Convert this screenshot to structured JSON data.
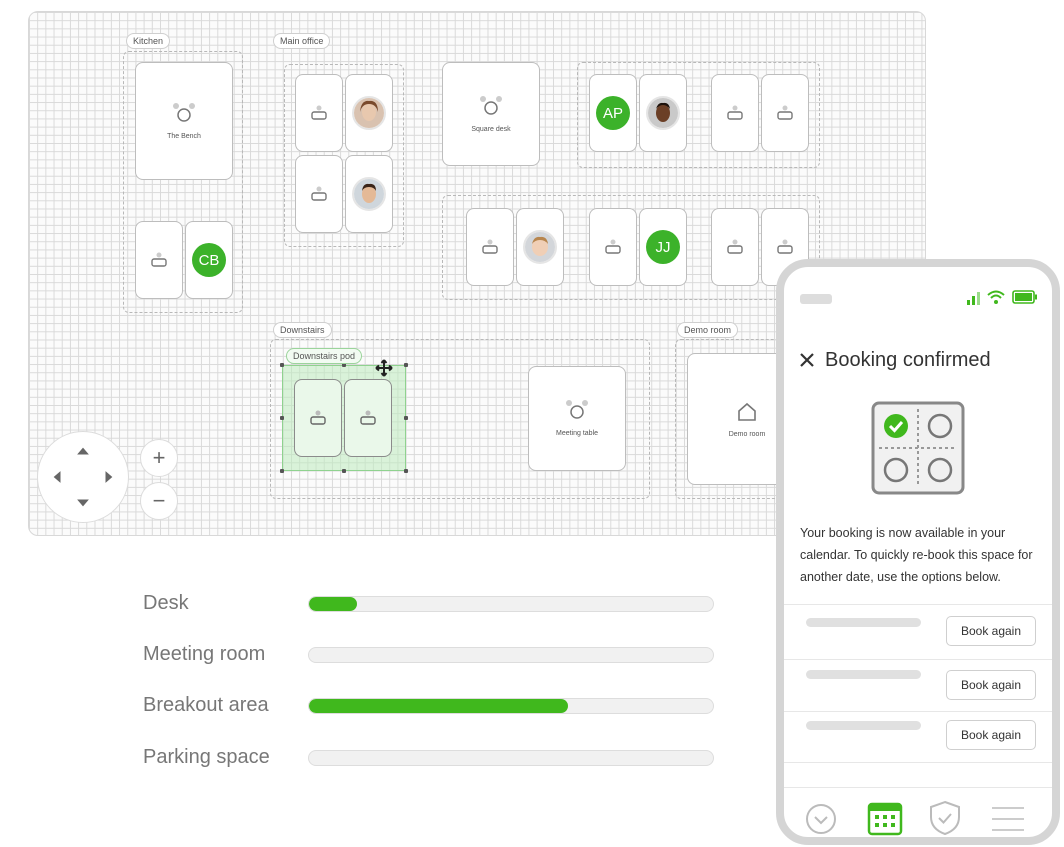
{
  "floorplan": {
    "zones": {
      "kitchen": "Kitchen",
      "main_office": "Main office",
      "downstairs": "Downstairs",
      "downstairs_pod": "Downstairs pod",
      "demo_room_zone": "Demo room"
    },
    "spaces": {
      "the_bench": "The Bench",
      "square_desk": "Square desk",
      "meeting_table": "Meeting table",
      "demo_room": "Demo room"
    },
    "avatars": {
      "ap": "AP",
      "cb": "CB",
      "jj": "JJ"
    },
    "controls": {
      "zoom_in": "+",
      "zoom_out": "−"
    }
  },
  "usage": [
    {
      "label": "Desk",
      "fraction": 0.12
    },
    {
      "label": "Meeting room",
      "fraction": 0
    },
    {
      "label": "Breakout area",
      "fraction": 0.64
    },
    {
      "label": "Parking space",
      "fraction": 0
    }
  ],
  "phone": {
    "title": "Booking confirmed",
    "message": "Your booking is now available in your calendar. To quickly re-book this space for another date, use the options below.",
    "rows": [
      {
        "button": "Book again"
      },
      {
        "button": "Book again"
      },
      {
        "button": "Book again"
      }
    ],
    "nav": [
      "check-circle-icon",
      "calendar-icon",
      "shield-check-icon",
      "menu-icon"
    ],
    "accent": "#40b81d"
  }
}
